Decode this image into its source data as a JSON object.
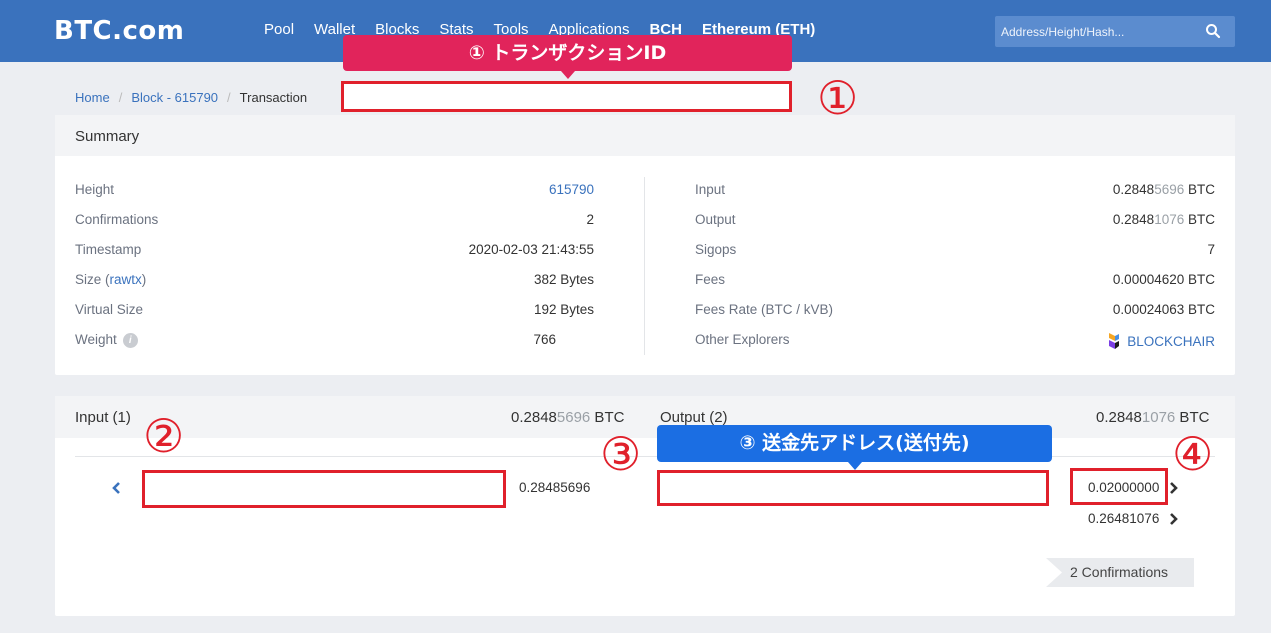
{
  "brand": "BTC.com",
  "nav": [
    "Pool",
    "Wallet",
    "Blocks",
    "Stats",
    "Tools",
    "Applications",
    "BCH",
    "Ethereum (ETH)"
  ],
  "search": {
    "placeholder": "Address/Height/Hash..."
  },
  "breadcrumb": {
    "home": "Home",
    "block": "Block - 615790",
    "current": "Transaction"
  },
  "summary": {
    "title": "Summary",
    "left": [
      {
        "label": "Height",
        "value": "615790"
      },
      {
        "label": "Confirmations",
        "value": "2"
      },
      {
        "label": "Timestamp",
        "value": "2020-02-03 21:43:55"
      },
      {
        "label": "Size",
        "label_link": "rawtx",
        "value": "382 Bytes"
      },
      {
        "label": "Virtual Size",
        "value": "192 Bytes"
      },
      {
        "label": "Weight",
        "value": "766"
      }
    ],
    "right": [
      {
        "label": "Input",
        "value_main": "0.2848",
        "value_faded": "5696",
        "unit": " BTC"
      },
      {
        "label": "Output",
        "value_main": "0.2848",
        "value_faded": "1076",
        "unit": " BTC"
      },
      {
        "label": "Sigops",
        "value": "7"
      },
      {
        "label": "Fees",
        "value": "0.00004620 BTC"
      },
      {
        "label": "Fees Rate (BTC / kVB)",
        "value": "0.00024063 BTC"
      },
      {
        "label": "Other Explorers",
        "value": "BLOCKCHAIR"
      }
    ]
  },
  "io": {
    "input_title": "Input (1)",
    "input_total_main": "0.2848",
    "input_total_faded": "5696",
    "input_unit": " BTC",
    "output_title": "Output (2)",
    "output_total_main": "0.2848",
    "output_total_faded": "1076",
    "output_unit": " BTC",
    "input_amount": "0.28485696",
    "outputs": [
      "0.02000000",
      "0.26481076"
    ],
    "confirmations": "2 Confirmations"
  },
  "annotations": {
    "c1": "① トランザクションID",
    "c3": "③ 送金先アドレス(送付先)",
    "n1": "①",
    "n2": "②",
    "n3": "③",
    "n4": "④"
  },
  "colors": {
    "topbar": "#3a72bd",
    "annotation_red": "#e0202b",
    "callout_pink": "#e1245b",
    "callout_blue": "#1b6ee3"
  }
}
